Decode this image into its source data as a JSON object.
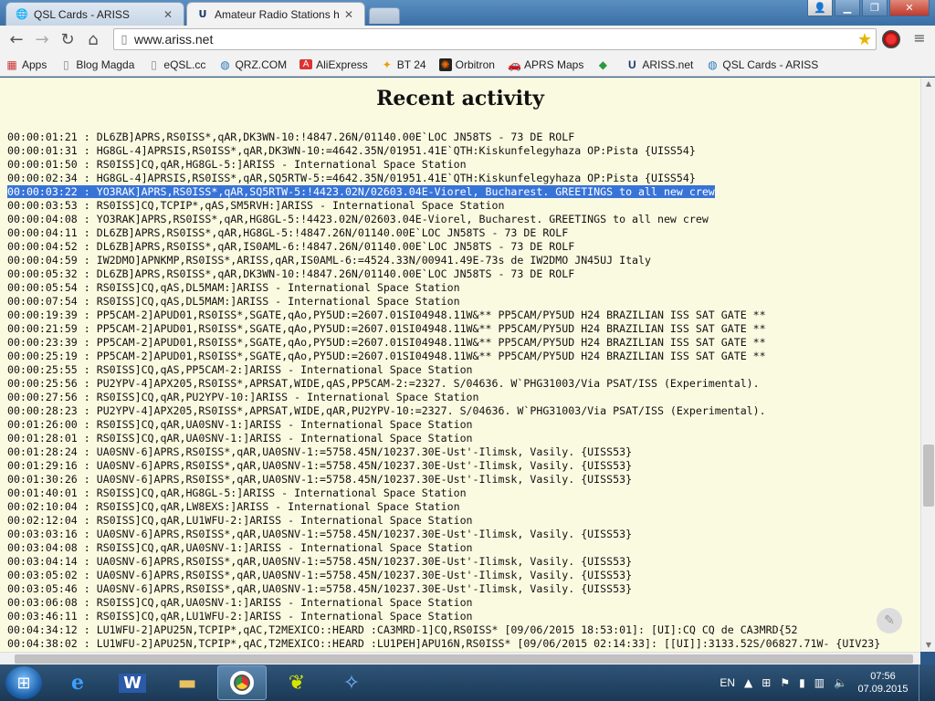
{
  "tabs": [
    {
      "title": "QSL Cards - ARISS",
      "favicon": "globe-icon"
    },
    {
      "title": "Amateur Radio Stations h",
      "favicon": "ariss-logo-icon"
    }
  ],
  "toolbar": {
    "url": "www.ariss.net"
  },
  "bookmarks": [
    {
      "label": "Apps",
      "icon": "apps-grid-icon"
    },
    {
      "label": "Blog Magda",
      "icon": "page-icon"
    },
    {
      "label": "eQSL.cc",
      "icon": "page-icon"
    },
    {
      "label": "QRZ.COM",
      "icon": "globe-icon"
    },
    {
      "label": "AliExpress",
      "icon": "aliexpress-icon"
    },
    {
      "label": "BT 24",
      "icon": "bt24-icon"
    },
    {
      "label": "Orbitron",
      "icon": "orbitron-icon"
    },
    {
      "label": "APRS Maps",
      "icon": "car-icon"
    },
    {
      "label": "",
      "icon": "diamond-icon"
    },
    {
      "label": "ARISS.net",
      "icon": "ariss-logo-icon"
    },
    {
      "label": "QSL Cards - ARISS",
      "icon": "globe-icon"
    }
  ],
  "page": {
    "title": "Recent activity",
    "selected_index": 4,
    "lines": [
      "00:00:01:21 : DL6ZB]APRS,RS0ISS*,qAR,DK3WN-10:!4847.26N/01140.00E`LOC JN58TS - 73 DE ROLF",
      "00:00:01:31 : HG8GL-4]APRSIS,RS0ISS*,qAR,DK3WN-10:=4642.35N/01951.41E`QTH:Kiskunfelegyhaza OP:Pista {UISS54}",
      "00:00:01:50 : RS0ISS]CQ,qAR,HG8GL-5:]ARISS - International Space Station",
      "00:00:02:34 : HG8GL-4]APRSIS,RS0ISS*,qAR,SQ5RTW-5:=4642.35N/01951.41E`QTH:Kiskunfelegyhaza OP:Pista {UISS54}",
      "00:00:03:22 : YO3RAK]APRS,RS0ISS*,qAR,SQ5RTW-5:!4423.02N/02603.04E-Viorel, Bucharest. GREETINGS to all new crew",
      "00:00:03:53 : RS0ISS]CQ,TCPIP*,qAS,SM5RVH:]ARISS - International Space Station",
      "00:00:04:08 : YO3RAK]APRS,RS0ISS*,qAR,HG8GL-5:!4423.02N/02603.04E-Viorel, Bucharest. GREETINGS to all new crew",
      "00:00:04:11 : DL6ZB]APRS,RS0ISS*,qAR,HG8GL-5:!4847.26N/01140.00E`LOC JN58TS - 73 DE ROLF",
      "00:00:04:52 : DL6ZB]APRS,RS0ISS*,qAR,IS0AML-6:!4847.26N/01140.00E`LOC JN58TS - 73 DE ROLF",
      "00:00:04:59 : IW2DMO]APNKMP,RS0ISS*,ARISS,qAR,IS0AML-6:=4524.33N/00941.49E-73s de IW2DMO JN45UJ Italy",
      "00:00:05:32 : DL6ZB]APRS,RS0ISS*,qAR,DK3WN-10:!4847.26N/01140.00E`LOC JN58TS - 73 DE ROLF",
      "00:00:05:54 : RS0ISS]CQ,qAS,DL5MAM:]ARISS - International Space Station",
      "00:00:07:54 : RS0ISS]CQ,qAS,DL5MAM:]ARISS - International Space Station",
      "00:00:19:39 : PP5CAM-2]APUD01,RS0ISS*,SGATE,qAo,PY5UD:=2607.01SI04948.11W&** PP5CAM/PY5UD H24 BRAZILIAN ISS SAT GATE **",
      "00:00:21:59 : PP5CAM-2]APUD01,RS0ISS*,SGATE,qAo,PY5UD:=2607.01SI04948.11W&** PP5CAM/PY5UD H24 BRAZILIAN ISS SAT GATE **",
      "00:00:23:39 : PP5CAM-2]APUD01,RS0ISS*,SGATE,qAo,PY5UD:=2607.01SI04948.11W&** PP5CAM/PY5UD H24 BRAZILIAN ISS SAT GATE **",
      "00:00:25:19 : PP5CAM-2]APUD01,RS0ISS*,SGATE,qAo,PY5UD:=2607.01SI04948.11W&** PP5CAM/PY5UD H24 BRAZILIAN ISS SAT GATE **",
      "00:00:25:55 : RS0ISS]CQ,qAS,PP5CAM-2:]ARISS - International Space Station",
      "00:00:25:56 : PU2YPV-4]APX205,RS0ISS*,APRSAT,WIDE,qAS,PP5CAM-2:=2327. S/04636. W`PHG31003/Via PSAT/ISS (Experimental).",
      "00:00:27:56 : RS0ISS]CQ,qAR,PU2YPV-10:]ARISS - International Space Station",
      "00:00:28:23 : PU2YPV-4]APX205,RS0ISS*,APRSAT,WIDE,qAR,PU2YPV-10:=2327. S/04636. W`PHG31003/Via PSAT/ISS (Experimental).",
      "00:01:26:00 : RS0ISS]CQ,qAR,UA0SNV-1:]ARISS - International Space Station",
      "00:01:28:01 : RS0ISS]CQ,qAR,UA0SNV-1:]ARISS - International Space Station",
      "00:01:28:24 : UA0SNV-6]APRS,RS0ISS*,qAR,UA0SNV-1:=5758.45N/10237.30E-Ust'-Ilimsk, Vasily. {UISS53}",
      "00:01:29:16 : UA0SNV-6]APRS,RS0ISS*,qAR,UA0SNV-1:=5758.45N/10237.30E-Ust'-Ilimsk, Vasily. {UISS53}",
      "00:01:30:26 : UA0SNV-6]APRS,RS0ISS*,qAR,UA0SNV-1:=5758.45N/10237.30E-Ust'-Ilimsk, Vasily. {UISS53}",
      "00:01:40:01 : RS0ISS]CQ,qAR,HG8GL-5:]ARISS - International Space Station",
      "00:02:10:04 : RS0ISS]CQ,qAR,LW8EXS:]ARISS - International Space Station",
      "00:02:12:04 : RS0ISS]CQ,qAR,LU1WFU-2:]ARISS - International Space Station",
      "00:03:03:16 : UA0SNV-6]APRS,RS0ISS*,qAR,UA0SNV-1:=5758.45N/10237.30E-Ust'-Ilimsk, Vasily. {UISS53}",
      "00:03:04:08 : RS0ISS]CQ,qAR,UA0SNV-1:]ARISS - International Space Station",
      "00:03:04:14 : UA0SNV-6]APRS,RS0ISS*,qAR,UA0SNV-1:=5758.45N/10237.30E-Ust'-Ilimsk, Vasily. {UISS53}",
      "00:03:05:02 : UA0SNV-6]APRS,RS0ISS*,qAR,UA0SNV-1:=5758.45N/10237.30E-Ust'-Ilimsk, Vasily. {UISS53}",
      "00:03:05:46 : UA0SNV-6]APRS,RS0ISS*,qAR,UA0SNV-1:=5758.45N/10237.30E-Ust'-Ilimsk, Vasily. {UISS53}",
      "00:03:06:08 : RS0ISS]CQ,qAR,UA0SNV-1:]ARISS - International Space Station",
      "00:03:46:11 : RS0ISS]CQ,qAR,LU1WFU-2:]ARISS - International Space Station",
      "00:04:34:12 : LU1WFU-2]APU25N,TCPIP*,qAC,T2MEXICO::HEARD :CA3MRD-1]CQ,RS0ISS* [09/06/2015 18:53:01]: [UI]:CQ CQ de CA3MRD{52",
      "00:04:38:02 : LU1WFU-2]APU25N,TCPIP*,qAC,T2MEXICO::HEARD :LU1PEH]APU16N,RS0ISS* [09/06/2015 02:14:33]: [[UI]]:3133.52S/06827.71W- {UIV23}"
    ]
  },
  "taskbar": {
    "apps": [
      {
        "name": "internet-explorer-icon",
        "active": false
      },
      {
        "name": "word-icon",
        "active": false
      },
      {
        "name": "file-explorer-icon",
        "active": false
      },
      {
        "name": "chrome-icon",
        "active": true
      },
      {
        "name": "butterfly-app-icon",
        "active": false
      },
      {
        "name": "satellite-app-icon",
        "active": false
      }
    ],
    "language": "EN",
    "time": "07:56",
    "date": "07.09.2015"
  }
}
